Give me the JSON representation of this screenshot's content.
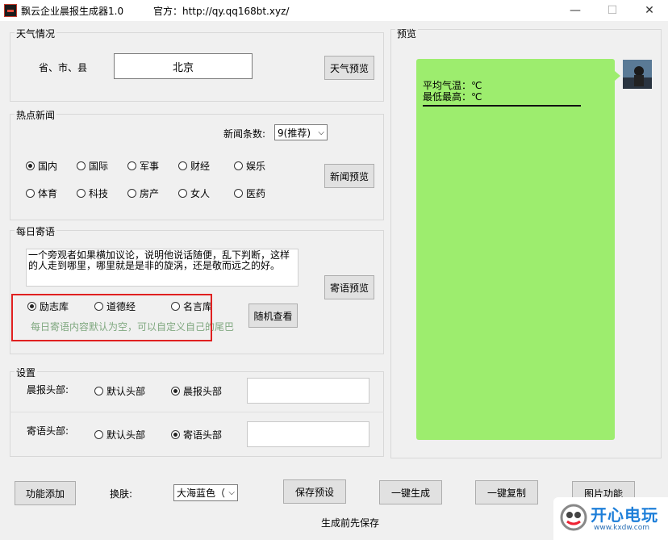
{
  "window": {
    "title": "飘云企业晨报生成器1.0",
    "site": "官方：http://qy.qq168bt.xyz/",
    "minimize": "—",
    "maximize": "☐",
    "close": "✕"
  },
  "weather": {
    "group_label": "天气情况",
    "region_label": "省、市、县",
    "region_value": "北京",
    "preview_button": "天气预览"
  },
  "news": {
    "group_label": "热点新闻",
    "count_label": "新闻条数:",
    "count_value": "9(推荐)",
    "categories": [
      {
        "label": "国内",
        "checked": true
      },
      {
        "label": "国际",
        "checked": false
      },
      {
        "label": "军事",
        "checked": false
      },
      {
        "label": "财经",
        "checked": false
      },
      {
        "label": "娱乐",
        "checked": false
      },
      {
        "label": "体育",
        "checked": false
      },
      {
        "label": "科技",
        "checked": false
      },
      {
        "label": "房产",
        "checked": false
      },
      {
        "label": "女人",
        "checked": false
      },
      {
        "label": "医药",
        "checked": false
      }
    ],
    "preview_button": "新闻预览"
  },
  "quote": {
    "group_label": "每日寄语",
    "text": "一个旁观者如果横加议论，说明他说话随便，乱下判断，这样的人走到哪里，哪里就是是非的旋涡，还是敬而远之的好。",
    "preview_button": "寄语预览",
    "sources": [
      {
        "label": "励志库",
        "checked": true
      },
      {
        "label": "道德经",
        "checked": false
      },
      {
        "label": "名言库",
        "checked": false
      }
    ],
    "random_button": "随机查看",
    "hint": "每日寄语内容默认为空，可以自定义自己的尾巴",
    "highlight_color": "#e02020",
    "hint_color": "#7fa87f"
  },
  "settings": {
    "group_label": "设置",
    "morning_header_label": "晨报头部:",
    "morning_default": "默认头部",
    "morning_custom": "晨报头部",
    "morning_selected": "晨报头部",
    "quote_header_label": "寄语头部:",
    "quote_default": "默认头部",
    "quote_custom": "寄语头部",
    "quote_selected": "寄语头部"
  },
  "preview": {
    "group_label": "预览",
    "line1": "平均气温：℃",
    "line2": "最低最高：℃",
    "bubble_color": "#9ded6e"
  },
  "toolbar": {
    "add_function": "功能添加",
    "skin_label": "换肤:",
    "skin_value": "大海蓝色（",
    "save_preset": "保存预设",
    "generate": "一键生成",
    "copy": "一键复制",
    "image_function": "图片功能",
    "footer_note": "生成前先保存"
  },
  "watermark": {
    "text": "开心电玩",
    "sub": "www.kxdw.com"
  }
}
